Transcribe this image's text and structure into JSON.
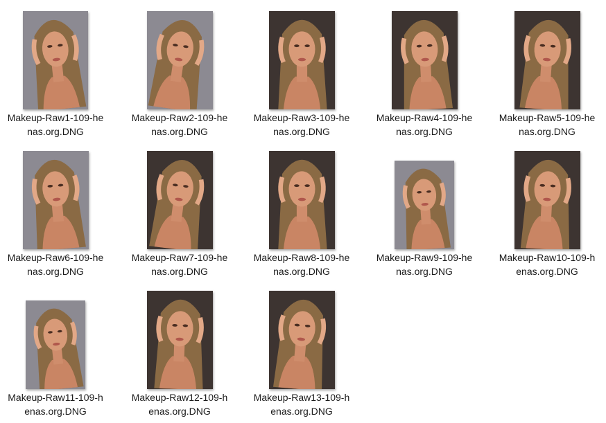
{
  "window": {
    "view": "Large icons"
  },
  "thumbnail_icon": "portrait-photo-thumbnail-icon",
  "colors": {
    "background": "#ffffff",
    "text": "#1a1a1a",
    "skin": "#d89a78",
    "hair": "#8a6a44",
    "backdrop_gray": "#8c8a92",
    "backdrop_dark": "#3d3431"
  },
  "files": [
    {
      "name": "Makeup-Raw1-109-henas.org.DNG",
      "line1": "Makeup-Raw1-109-he",
      "line2": "nas.org.DNG",
      "backdrop": "gray"
    },
    {
      "name": "Makeup-Raw2-109-henas.org.DNG",
      "line1": "Makeup-Raw2-109-he",
      "line2": "nas.org.DNG",
      "backdrop": "gray"
    },
    {
      "name": "Makeup-Raw3-109-henas.org.DNG",
      "line1": "Makeup-Raw3-109-he",
      "line2": "nas.org.DNG",
      "backdrop": "dark"
    },
    {
      "name": "Makeup-Raw4-109-henas.org.DNG",
      "line1": "Makeup-Raw4-109-he",
      "line2": "nas.org.DNG",
      "backdrop": "dark"
    },
    {
      "name": "Makeup-Raw5-109-henas.org.DNG",
      "line1": "Makeup-Raw5-109-he",
      "line2": "nas.org.DNG",
      "backdrop": "dark"
    },
    {
      "name": "Makeup-Raw6-109-henas.org.DNG",
      "line1": "Makeup-Raw6-109-he",
      "line2": "nas.org.DNG",
      "backdrop": "gray"
    },
    {
      "name": "Makeup-Raw7-109-henas.org.DNG",
      "line1": "Makeup-Raw7-109-he",
      "line2": "nas.org.DNG",
      "backdrop": "dark"
    },
    {
      "name": "Makeup-Raw8-109-henas.org.DNG",
      "line1": "Makeup-Raw8-109-he",
      "line2": "nas.org.DNG",
      "backdrop": "dark"
    },
    {
      "name": "Makeup-Raw9-109-henas.org.DNG",
      "line1": "Makeup-Raw9-109-he",
      "line2": "nas.org.DNG",
      "backdrop": "gray"
    },
    {
      "name": "Makeup-Raw10-109-henas.org.DNG",
      "line1": "Makeup-Raw10-109-h",
      "line2": "enas.org.DNG",
      "backdrop": "dark"
    },
    {
      "name": "Makeup-Raw11-109-henas.org.DNG",
      "line1": "Makeup-Raw11-109-h",
      "line2": "enas.org.DNG",
      "backdrop": "gray"
    },
    {
      "name": "Makeup-Raw12-109-henas.org.DNG",
      "line1": "Makeup-Raw12-109-h",
      "line2": "enas.org.DNG",
      "backdrop": "dark"
    },
    {
      "name": "Makeup-Raw13-109-henas.org.DNG",
      "line1": "Makeup-Raw13-109-h",
      "line2": "enas.org.DNG",
      "backdrop": "dark"
    }
  ]
}
